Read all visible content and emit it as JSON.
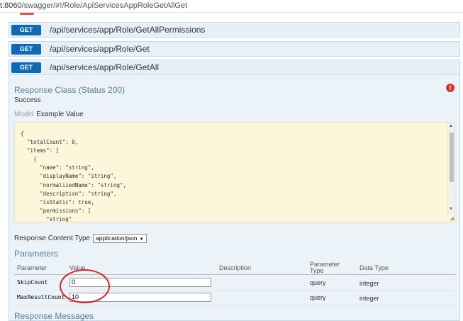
{
  "browser": {
    "url_prefix": "t:8060",
    "url_rest": "/swagger/#!/Role/ApiServicesAppRoleGetAllGet"
  },
  "operations": [
    {
      "verb": "GET",
      "path": "/api/services/app/Role/GetAllPermissions"
    },
    {
      "verb": "GET",
      "path": "/api/services/app/Role/Get"
    },
    {
      "verb": "GET",
      "path": "/api/services/app/Role/GetAll"
    }
  ],
  "response": {
    "heading": "Response Class (Status 200)",
    "description": "Success",
    "error_icon": "!",
    "tab_model": "Model",
    "tab_example": "Example Value",
    "example_json": "{\n  \"totalCount\": 0,\n  \"items\": [\n    {\n      \"name\": \"string\",\n      \"displayName\": \"string\",\n      \"normalizedName\": \"string\",\n      \"description\": \"string\",\n      \"isStatic\": true,\n      \"permissions\": [\n        \"string\""
  },
  "content_type": {
    "label": "Response Content Type",
    "value": "application/json"
  },
  "parameters": {
    "heading": "Parameters",
    "columns": {
      "parameter": "Parameter",
      "value": "Value",
      "description": "Description",
      "param_type": "Parameter Type",
      "data_type": "Data Type"
    },
    "rows": [
      {
        "name": "SkipCount",
        "value": "0",
        "type": "query",
        "data_type": "integer"
      },
      {
        "name": "MaxResultCount",
        "value": "10",
        "type": "query",
        "data_type": "integer"
      }
    ]
  },
  "messages_heading": "Response Messages",
  "colors": {
    "verb_get": "#0f6ab4",
    "panel_bg": "#ebf3f9",
    "heading": "#547f9c",
    "code_bg": "#fcf6db",
    "annotation": "#e02020"
  }
}
